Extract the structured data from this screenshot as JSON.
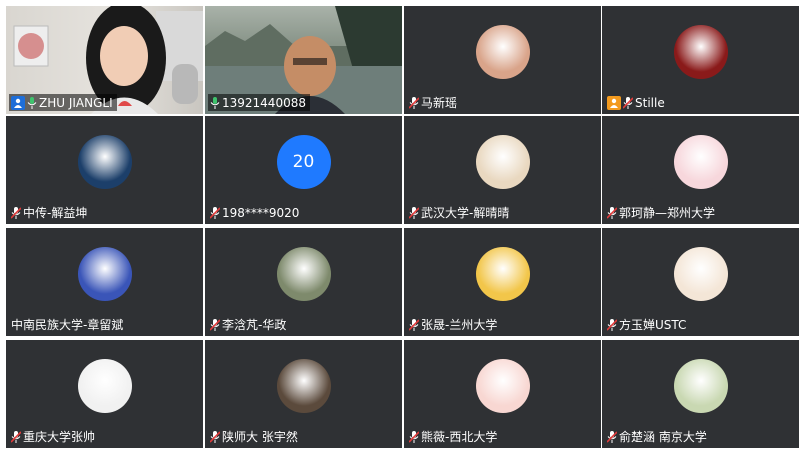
{
  "participants": [
    {
      "name": "ZHU JIANGLI",
      "mic": "on",
      "role": "host",
      "view": "video",
      "active": true
    },
    {
      "name": "13921440088",
      "mic": "on",
      "role": "",
      "view": "video"
    },
    {
      "name": "马新瑶",
      "mic": "muted",
      "role": "",
      "view": "avatar",
      "avatar_color": "#d9a48a"
    },
    {
      "name": "Stille",
      "mic": "muted",
      "role": "cohost",
      "view": "avatar",
      "avatar_color": "#8a1a1a"
    },
    {
      "name": "中传-解益坤",
      "mic": "muted",
      "role": "",
      "view": "avatar",
      "avatar_color": "#1c3f6a"
    },
    {
      "name": "198****9020",
      "mic": "muted",
      "role": "",
      "view": "number",
      "avatar_text": "20",
      "avatar_color": "#1f7aff"
    },
    {
      "name": "武汉大学-解晴晴",
      "mic": "muted",
      "role": "",
      "view": "avatar",
      "avatar_color": "#e9d8c0"
    },
    {
      "name": "郭珂静—郑州大学",
      "mic": "muted",
      "role": "",
      "view": "avatar",
      "avatar_color": "#f7d7dc"
    },
    {
      "name": "中南民族大学-章留斌",
      "mic": "none",
      "role": "",
      "view": "avatar",
      "avatar_color": "#3a55b8"
    },
    {
      "name": "李浛芃-华政",
      "mic": "muted",
      "role": "",
      "view": "avatar",
      "avatar_color": "#7e8a6c"
    },
    {
      "name": "张晟-兰州大学",
      "mic": "muted",
      "role": "",
      "view": "avatar",
      "avatar_color": "#f2c64a"
    },
    {
      "name": "方玉婵USTC",
      "mic": "muted",
      "role": "",
      "view": "avatar",
      "avatar_color": "#f4e6d7"
    },
    {
      "name": "重庆大学张帅",
      "mic": "muted",
      "role": "",
      "view": "avatar",
      "avatar_color": "#f1f1f1"
    },
    {
      "name": "陕师大 张宇然",
      "mic": "muted",
      "role": "",
      "view": "avatar",
      "avatar_color": "#5b4a3c"
    },
    {
      "name": "熊薇-西北大学",
      "mic": "muted",
      "role": "",
      "view": "avatar",
      "avatar_color": "#f8d7d2"
    },
    {
      "name": "俞楚涵 南京大学",
      "mic": "muted",
      "role": "",
      "view": "avatar",
      "avatar_color": "#c9d8b2"
    }
  ]
}
